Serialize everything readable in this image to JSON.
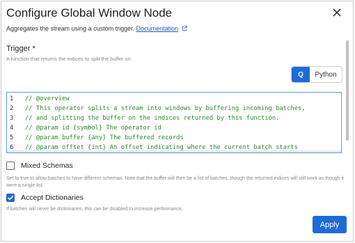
{
  "dialog": {
    "title": "Configure Global Window Node",
    "subtitle": "Aggregates the stream using a custom trigger.",
    "doc_link": "Documentation",
    "icons": {
      "close": "close-icon",
      "external": "external-link-icon"
    }
  },
  "trigger": {
    "label": "Trigger *",
    "description": "A function that returns the indices to split the buffer on.",
    "languages": [
      "Q",
      "Python"
    ],
    "selected_language": "Q"
  },
  "editor": {
    "lines": [
      {
        "num": "1",
        "text": "// @overview"
      },
      {
        "num": "2",
        "text": "// This operator splits a stream into windows by buffering incoming batches,"
      },
      {
        "num": "3",
        "text": "// and splitting the buffer on the indices returned by this function."
      },
      {
        "num": "4",
        "text": "// @param id {symbol} The operator id"
      },
      {
        "num": "5",
        "text": "// @param buffer {any} The buffered records"
      },
      {
        "num": "6",
        "text": "// @param offset {int} An offset indicating where the current batch starts"
      }
    ]
  },
  "mixed_schemas": {
    "label": "Mixed Schemas",
    "checked": false,
    "description": "Set to true to allow batches to have different schemas. Note that the buffer will then be a list of batches, though the returned indices will still work as though it were a single list."
  },
  "accept_dictionaries": {
    "label": "Accept Dictionaries",
    "checked": true,
    "description": "If batches will never be dictionaries, this can be disabled to increase performance."
  },
  "footer": {
    "apply_label": "Apply"
  },
  "colors": {
    "accent": "#1e6bd6",
    "comment": "#2e8b2e",
    "line_number": "#2a2a8a"
  }
}
